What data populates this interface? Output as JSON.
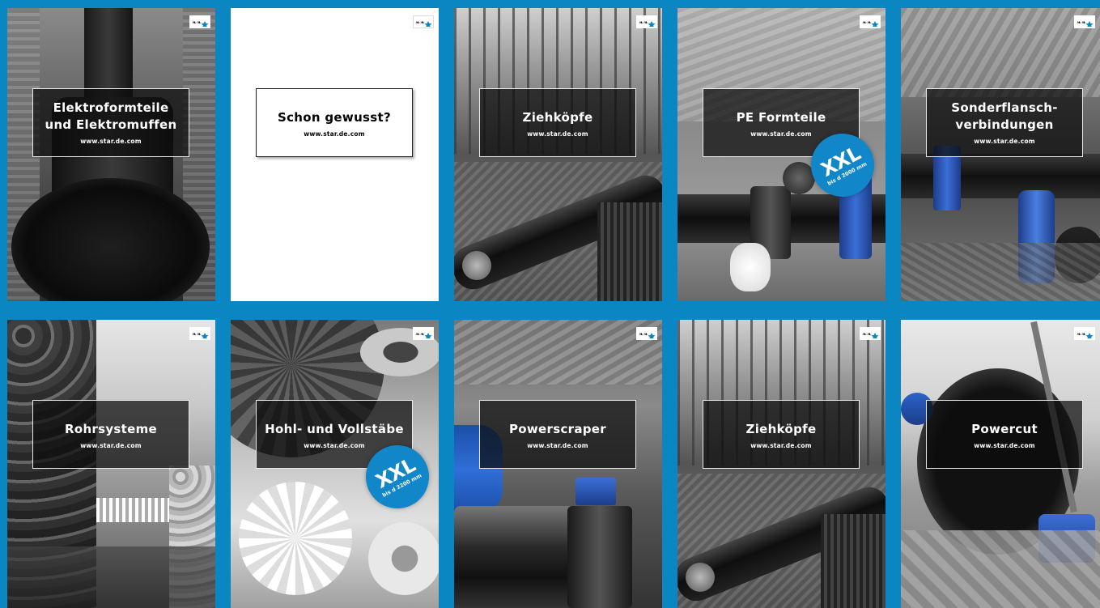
{
  "cards": [
    {
      "title": "Elektroformteile\nund Elektromuffen",
      "url": "www.star.de.com",
      "theme": "pipe-trench"
    },
    {
      "title": "Schon gewusst?",
      "url": "www.star.de.com",
      "theme": "white"
    },
    {
      "title": "Ziehköpfe",
      "url": "www.star.de.com",
      "theme": "forest-pipe"
    },
    {
      "title": "PE Formteile",
      "url": "www.star.de.com",
      "theme": "valve",
      "badge": {
        "main": "XXL",
        "sub": "bis d 2000 mm"
      }
    },
    {
      "title": "Sonderflansch-\nverbindungen",
      "url": "www.star.de.com",
      "theme": "flange"
    },
    {
      "title": "Rohrsysteme",
      "url": "www.star.de.com",
      "theme": "pipe-stack"
    },
    {
      "title": "Hohl- und Vollstäbe",
      "url": "www.star.de.com",
      "theme": "gears",
      "badge": {
        "main": "XXL",
        "sub": "bis d 2200 mm"
      }
    },
    {
      "title": "Powerscraper",
      "url": "www.star.de.com",
      "theme": "scraper"
    },
    {
      "title": "Ziehköpfe",
      "url": "www.star.de.com",
      "theme": "forest-pipe"
    },
    {
      "title": "Powercut",
      "url": "www.star.de.com",
      "theme": "cutter"
    }
  ],
  "colors": {
    "background": "#0a86c2",
    "badge": "#1186c8",
    "accent_blue": "#2a6ad0"
  },
  "logo_icon": "star-logo-icon"
}
